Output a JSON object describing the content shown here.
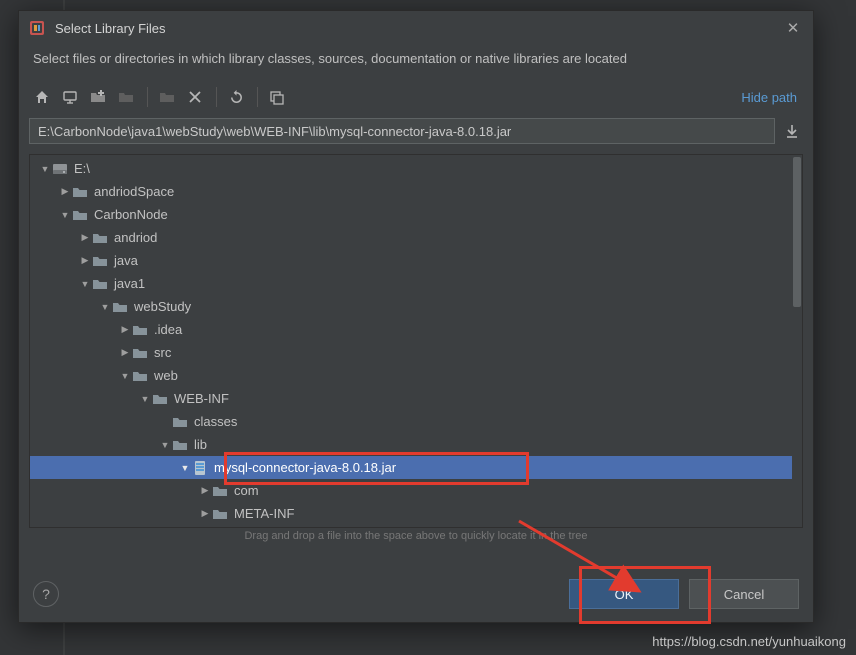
{
  "dialog": {
    "title": "Select Library Files",
    "description": "Select files or directories in which library classes, sources, documentation or native libraries are located",
    "hide_path_label": "Hide path",
    "path_value": "E:\\CarbonNode\\java1\\webStudy\\web\\WEB-INF\\lib\\mysql-connector-java-8.0.18.jar",
    "hint": "Drag and drop a file into the space above to quickly locate it in the tree",
    "ok_label": "OK",
    "cancel_label": "Cancel",
    "help_label": "?"
  },
  "toolbar": {
    "home": "home-icon",
    "desktop": "desktop-icon",
    "new_folder": "new-folder-icon",
    "new_folder_disabled": "new-folder-disabled-icon",
    "folder_star": "folder-star-icon",
    "delete": "delete-icon",
    "refresh": "refresh-icon",
    "show_hidden": "show-hidden-icon"
  },
  "tree": [
    {
      "depth": 0,
      "arrow": "down",
      "icon": "disk",
      "label": "E:\\"
    },
    {
      "depth": 1,
      "arrow": "right",
      "icon": "folder",
      "label": "andriodSpace"
    },
    {
      "depth": 1,
      "arrow": "down",
      "icon": "folder",
      "label": "CarbonNode"
    },
    {
      "depth": 2,
      "arrow": "right",
      "icon": "folder",
      "label": "andriod"
    },
    {
      "depth": 2,
      "arrow": "right",
      "icon": "folder",
      "label": "java"
    },
    {
      "depth": 2,
      "arrow": "down",
      "icon": "folder",
      "label": "java1"
    },
    {
      "depth": 3,
      "arrow": "down",
      "icon": "folder",
      "label": "webStudy"
    },
    {
      "depth": 4,
      "arrow": "right",
      "icon": "folder",
      "label": ".idea"
    },
    {
      "depth": 4,
      "arrow": "right",
      "icon": "folder",
      "label": "src"
    },
    {
      "depth": 4,
      "arrow": "down",
      "icon": "folder",
      "label": "web"
    },
    {
      "depth": 5,
      "arrow": "down",
      "icon": "folder",
      "label": "WEB-INF"
    },
    {
      "depth": 6,
      "arrow": "none",
      "icon": "folder",
      "label": "classes"
    },
    {
      "depth": 6,
      "arrow": "down",
      "icon": "folder",
      "label": "lib"
    },
    {
      "depth": 7,
      "arrow": "down",
      "icon": "jar",
      "label": "mysql-connector-java-8.0.18.jar",
      "selected": true
    },
    {
      "depth": 8,
      "arrow": "right",
      "icon": "folder",
      "label": "com"
    },
    {
      "depth": 8,
      "arrow": "right",
      "icon": "folder",
      "label": "META-INF"
    }
  ],
  "watermark": "https://blog.csdn.net/yunhuaikong"
}
